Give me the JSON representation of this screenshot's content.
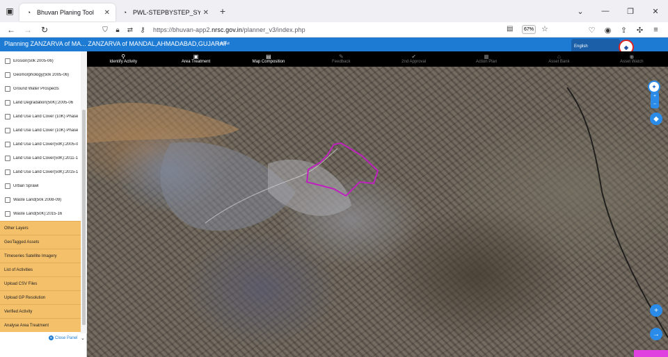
{
  "browser": {
    "tabs": [
      {
        "title": "Bhuvan Planing Tool",
        "active": true
      },
      {
        "title": "PWL-STEPBYSTEP_SYMBOL.pdf",
        "active": false
      }
    ],
    "url_prefix": "https://bhuvan-app2.",
    "url_domain": "nrsc.gov.in",
    "url_path": "/planner_v3/index.php",
    "zoom": "67%"
  },
  "app": {
    "title": "Planning ZANZARVA of MA... ZANZARVA of MANDAL,AHMADABAD,GUJARAT",
    "logout": "Logout",
    "language": "English"
  },
  "toolbar": [
    {
      "label": "Identify Activity",
      "icon": "⚲",
      "enabled": true
    },
    {
      "label": "Area Treatment",
      "icon": "▣",
      "enabled": true
    },
    {
      "label": "Map Composition",
      "icon": "▤",
      "enabled": true
    },
    {
      "label": "Feedback",
      "icon": "✎",
      "enabled": false
    },
    {
      "label": "2nd Approval",
      "icon": "✔",
      "enabled": false
    },
    {
      "label": "Action Plan",
      "icon": "▦",
      "enabled": false
    },
    {
      "label": "Asset Bank",
      "icon": "⌂",
      "enabled": false
    },
    {
      "label": "Asset Watch",
      "icon": "◉",
      "enabled": false
    }
  ],
  "layers": [
    "Erosion(50k 2005-06)",
    "Geomorphology(50k 2005-06)",
    "Ground Water Prospects",
    "Land Degradation(50K):2005-06",
    "Land Use Land Cover (10K) Phase",
    "Land Use Land Cover (10K) Phase",
    "Land Use Land Cover(50K):2005-0",
    "Land Use Land Cover(50K):2011-1",
    "Land Use Land Cover(50K):2015-1",
    "Urban Sprawl",
    "Waste Land(50k 2008-09)",
    "Waste Land(50K):2015-16"
  ],
  "sections": [
    "Other Layers",
    "GeoTagged Assets",
    "Timeseries Satellite Imagery",
    "List of Activities",
    "Upload CSV Files",
    "Upload GP Resolution",
    "Verified Activity",
    "Analyse Area Treatment"
  ],
  "close_panel": "Close Panel",
  "colors": {
    "header": "#1e7bd4",
    "section": "#f5c06a",
    "boundary": "#c020c0",
    "map_button": "#2b8be8"
  }
}
